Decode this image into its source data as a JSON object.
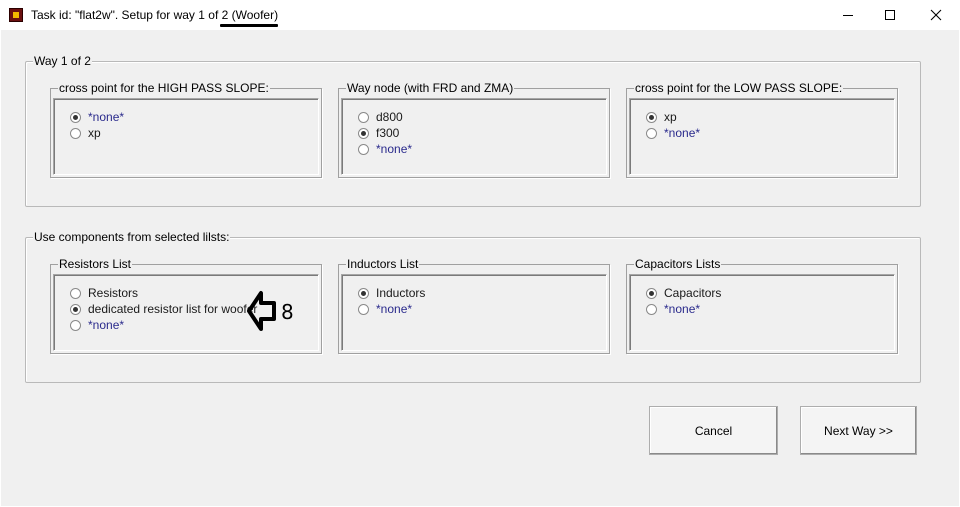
{
  "window": {
    "title": "Task id: \"flat2w\". Setup for way 1 of 2 (Woofer)",
    "minimize_icon": "minimize-icon",
    "maximize_icon": "maximize-icon",
    "close_icon": "close-icon"
  },
  "way_group": {
    "label": "Way 1 of 2",
    "high_pass": {
      "label": "cross point for the HIGH PASS SLOPE:",
      "options": [
        "*none*",
        "xp"
      ],
      "selected": "*none*"
    },
    "way_node": {
      "label": "Way node (with FRD and ZMA)",
      "options": [
        "d800",
        "f300",
        "*none*"
      ],
      "selected": "f300"
    },
    "low_pass": {
      "label": "cross point for the LOW PASS SLOPE:",
      "options": [
        "xp",
        "*none*"
      ],
      "selected": "xp"
    }
  },
  "components_group": {
    "label": "Use components from selected lilsts:",
    "resistors": {
      "label": "Resistors List",
      "options": [
        "Resistors",
        "dedicated resistor list for woofer",
        "*none*"
      ],
      "selected": "dedicated resistor list for woofer"
    },
    "inductors": {
      "label": "Inductors List",
      "options": [
        "Inductors",
        "*none*"
      ],
      "selected": "Inductors"
    },
    "capacitors": {
      "label": "Capacitors Lists",
      "options": [
        "Capacitors",
        "*none*"
      ],
      "selected": "Capacitors"
    }
  },
  "annotation": {
    "icon": "left-arrow-icon",
    "number": "8"
  },
  "buttons": {
    "cancel": "Cancel",
    "next": "Next Way >>"
  }
}
